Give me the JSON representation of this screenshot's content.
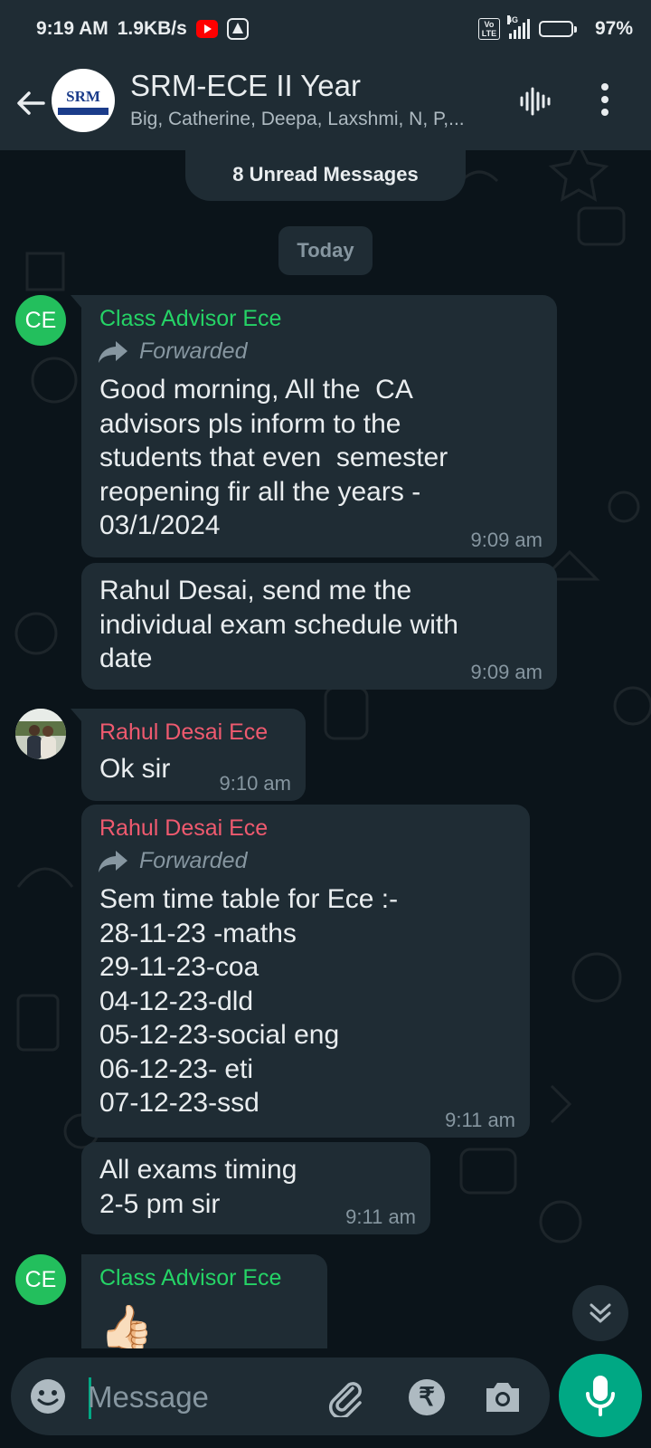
{
  "status_bar": {
    "time": "9:19 AM",
    "speed": "1.9KB/s",
    "network": "4G",
    "volte": "Vo LTE",
    "battery": "97%",
    "icons": [
      "youtube-icon",
      "a-icon",
      "volte-icon",
      "signal-icon",
      "battery-icon"
    ]
  },
  "header": {
    "title": "SRM-ECE II Year",
    "subtitle": "Big, Catherine, Deepa, Laxshmi, N, P,...",
    "avatar_logo": "SRM",
    "avatar_tagline": "TIRUCHIRAPPALLI",
    "icons": [
      "back-arrow-icon",
      "voice-call-icon",
      "more-options-icon"
    ]
  },
  "unread_chip": "8 Unread Messages",
  "date_chip": "Today",
  "messages": [
    {
      "avatar": "CE",
      "sender": "Class Advisor Ece",
      "forwarded": "Forwarded",
      "text": "Good morning, All the  CA\nadvisors pls inform to the\nstudents that even  semester\nreopening fir all the years -\n03/1/2024",
      "time": "9:09 am"
    },
    {
      "text": "Rahul Desai, send me the\nindividual exam schedule with\ndate",
      "time": "9:09 am"
    },
    {
      "sender": "Rahul Desai Ece",
      "text": "Ok sir",
      "time": "9:10 am"
    },
    {
      "sender": "Rahul Desai Ece",
      "forwarded": "Forwarded",
      "text": "Sem time table for Ece :-\n28-11-23 -maths\n29-11-23-coa\n04-12-23-dld\n05-12-23-social eng\n06-12-23- eti\n07-12-23-ssd",
      "time": "9:11 am"
    },
    {
      "text": "All exams timing\n2-5 pm sir",
      "time": "9:11 am"
    },
    {
      "avatar": "CE",
      "sender": "Class Advisor Ece",
      "text": "👍🏻"
    }
  ],
  "input": {
    "placeholder": "Message",
    "icons": [
      "emoji-icon",
      "attach-icon",
      "rupee-icon",
      "camera-icon",
      "mic-icon"
    ]
  },
  "colors": {
    "background": "#0b141a",
    "panel": "#1f2c34",
    "accent": "#00a884",
    "sender_green": "#25d366",
    "sender_red": "#ef5a6f",
    "avatar_green": "#23bf5d"
  }
}
